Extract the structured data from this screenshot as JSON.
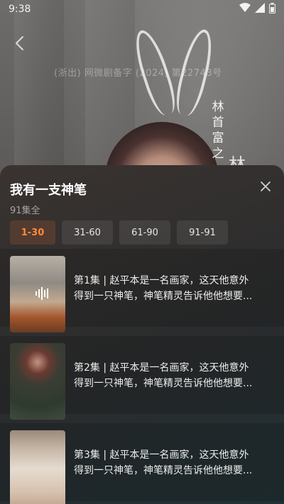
{
  "status_bar": {
    "time": "9:38"
  },
  "player": {
    "license_text": "(浙出) 网微剧备字 (2024) 第22743号",
    "vertical_title_chars": [
      "林",
      "首",
      "富",
      "之"
    ],
    "vertical_big_char": "林"
  },
  "sheet": {
    "title": "我有一支神笔",
    "episode_count": "91集全",
    "tabs": [
      {
        "label": "1-30",
        "active": true
      },
      {
        "label": "31-60",
        "active": false
      },
      {
        "label": "61-90",
        "active": false
      },
      {
        "label": "91-91",
        "active": false
      }
    ],
    "episodes": [
      {
        "line1": "第1集 | 赵平本是一名画家，这天他意外",
        "line2": "得到一只神笔，神笔精灵告诉他他想要..."
      },
      {
        "line1": "第2集 | 赵平本是一名画家，这天他意外",
        "line2": "得到一只神笔，神笔精灵告诉他他想要..."
      },
      {
        "line1": "第3集 | 赵平本是一名画家，这天他意外",
        "line2": "得到一只神笔，神笔精灵告诉他他想要..."
      }
    ]
  },
  "colors": {
    "accent": "#ff8a3d",
    "active_tab_bg": "#533c2f"
  },
  "icons": [
    "wifi-icon",
    "signal-icon",
    "battery-icon",
    "back-arrow-icon",
    "close-icon",
    "audio-wave-icon"
  ]
}
